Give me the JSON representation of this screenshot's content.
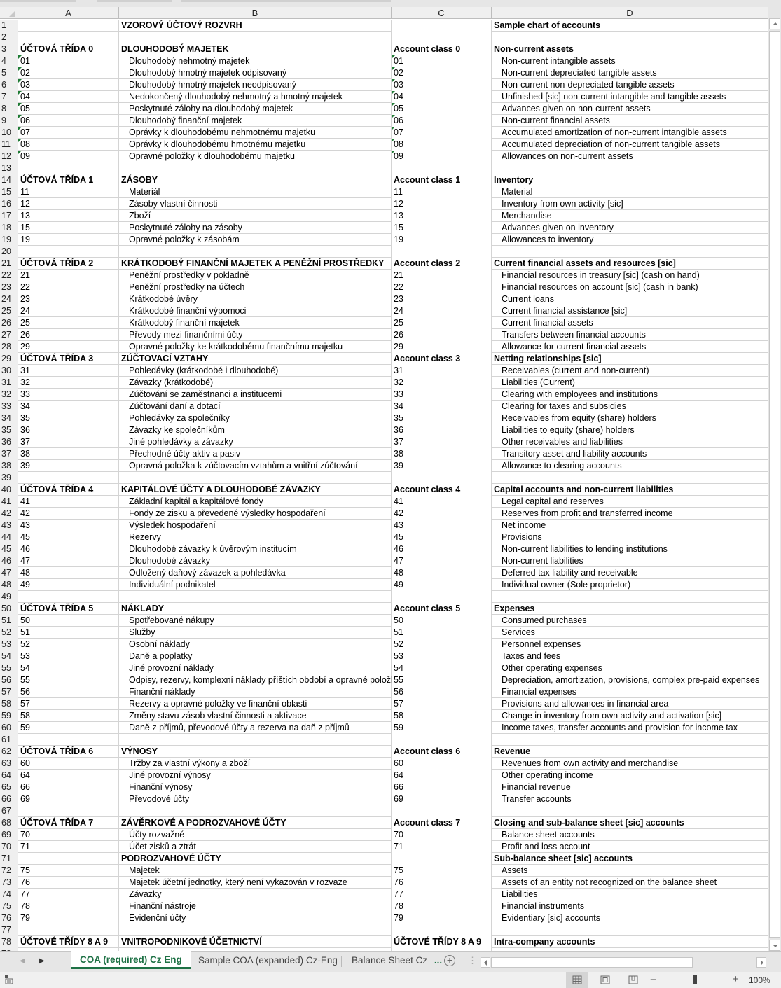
{
  "columns": [
    "A",
    "B",
    "C",
    "D"
  ],
  "rows": [
    {
      "n": "1",
      "a": "",
      "b": "VZOROVÝ ÚČTOVÝ ROZVRH",
      "c": "",
      "d": "Sample chart of accounts",
      "type": "title"
    },
    {
      "n": "2",
      "a": "",
      "b": "",
      "c": "",
      "d": "",
      "type": "blank"
    },
    {
      "n": "3",
      "a": "ÚČTOVÁ TŘÍDA 0",
      "b": "DLOUHODOBÝ MAJETEK",
      "c": "Account class 0",
      "d": "Non-current assets",
      "type": "header"
    },
    {
      "n": "4",
      "a": "01",
      "b": "Dlouhodobý nehmotný majetek",
      "c": "01",
      "d": "Non-current intangible assets",
      "type": "item",
      "tri": true
    },
    {
      "n": "5",
      "a": "02",
      "b": "Dlouhodobý hmotný majetek odpisovaný",
      "c": "02",
      "d": "Non-current depreciated tangible assets",
      "type": "item",
      "tri": true
    },
    {
      "n": "6",
      "a": "03",
      "b": "Dlouhodobý hmotný majetek neodpisovaný",
      "c": "03",
      "d": "Non-current non-depreciated tangible assets",
      "type": "item",
      "tri": true
    },
    {
      "n": "7",
      "a": "04",
      "b": "Nedokončený dlouhodobý nehmotný a hmotný majetek",
      "c": "04",
      "d": "Unfinished [sic] non-current intangible and tangible assets",
      "type": "item",
      "tri": true
    },
    {
      "n": "8",
      "a": "05",
      "b": "Poskytnuté zálohy na dlouhodobý majetek",
      "c": "05",
      "d": "Advances given on non-current assets",
      "type": "item",
      "tri": true
    },
    {
      "n": "9",
      "a": "06",
      "b": "Dlouhodobý finanční majetek",
      "c": "06",
      "d": "Non-current financial assets",
      "type": "item",
      "tri": true
    },
    {
      "n": "10",
      "a": "07",
      "b": "Oprávky k dlouhodobému nehmotnému majetku",
      "c": "07",
      "d": "Accumulated amortization of non-current intangible assets",
      "type": "item",
      "tri": true
    },
    {
      "n": "11",
      "a": "08",
      "b": "Oprávky k dlouhodobému hmotnému majetku",
      "c": "08",
      "d": "Accumulated depreciation of non-current tangible assets",
      "type": "item",
      "tri": true
    },
    {
      "n": "12",
      "a": "09",
      "b": "Opravné položky k dlouhodobému majetku",
      "c": "09",
      "d": "Allowances on non-current assets",
      "type": "item",
      "tri": true
    },
    {
      "n": "13",
      "a": "",
      "b": "",
      "c": "",
      "d": "",
      "type": "blank"
    },
    {
      "n": "14",
      "a": "ÚČTOVÁ TŘÍDA 1",
      "b": "ZÁSOBY",
      "c": "Account class 1",
      "d": "Inventory",
      "type": "header"
    },
    {
      "n": "15",
      "a": "11",
      "b": "Materiál",
      "c": "11",
      "d": "Material",
      "type": "item"
    },
    {
      "n": "16",
      "a": "12",
      "b": "Zásoby vlastní činnosti",
      "c": "12",
      "d": "Inventory from own activity [sic]",
      "type": "item"
    },
    {
      "n": "17",
      "a": "13",
      "b": "Zboží",
      "c": "13",
      "d": "Merchandise",
      "type": "item"
    },
    {
      "n": "18",
      "a": "15",
      "b": "Poskytnuté zálohy na zásoby",
      "c": "15",
      "d": "Advances given on inventory",
      "type": "item"
    },
    {
      "n": "19",
      "a": "19",
      "b": "Opravné položky k zásobám",
      "c": "19",
      "d": "Allowances to inventory",
      "type": "item"
    },
    {
      "n": "20",
      "a": "",
      "b": "",
      "c": "",
      "d": "",
      "type": "blank"
    },
    {
      "n": "21",
      "a": "ÚČTOVÁ TŘÍDA 2",
      "b": "KRÁTKODOBÝ FINANČNÍ MAJETEK A PENĚŽNÍ PROSTŘEDKY",
      "c": "Account class 2",
      "d": "Current financial assets and resources [sic]",
      "type": "header"
    },
    {
      "n": "22",
      "a": "21",
      "b": "Peněžní prostředky v pokladně",
      "c": "21",
      "d": "Financial resources in treasury [sic] (cash on hand)",
      "type": "item"
    },
    {
      "n": "23",
      "a": "22",
      "b": "Peněžní prostředky na účtech",
      "c": "22",
      "d": "Financial resources on account [sic] (cash in bank)",
      "type": "item"
    },
    {
      "n": "24",
      "a": "23",
      "b": "Krátkodobé úvěry",
      "c": "23",
      "d": "Current loans",
      "type": "item"
    },
    {
      "n": "25",
      "a": "24",
      "b": "Krátkodobé finanční výpomoci",
      "c": "24",
      "d": "Current financial assistance [sic]",
      "type": "item"
    },
    {
      "n": "26",
      "a": "25",
      "b": "Krátkodobý finanční majetek",
      "c": "25",
      "d": "Current financial assets",
      "type": "item"
    },
    {
      "n": "27",
      "a": "26",
      "b": "Převody mezi finančními účty",
      "c": "26",
      "d": "Transfers between financial accounts",
      "type": "item"
    },
    {
      "n": "28",
      "a": "29",
      "b": "Opravné položky ke krátkodobému finančnímu majetku",
      "c": "29",
      "d": "Allowance for current financial assets",
      "type": "item"
    },
    {
      "n": "29",
      "a": "ÚČTOVÁ TŘÍDA 3",
      "b": "ZÚČTOVACÍ VZTAHY",
      "c": "Account class 3",
      "d": "Netting relationships [sic]",
      "type": "header"
    },
    {
      "n": "30",
      "a": "31",
      "b": "Pohledávky (krátkodobé i dlouhodobé)",
      "c": "31",
      "d": "Receivables (current and non-current)",
      "type": "item"
    },
    {
      "n": "31",
      "a": "32",
      "b": "Závazky (krátkodobé)",
      "c": "32",
      "d": "Liabilities (Current)",
      "type": "item"
    },
    {
      "n": "32",
      "a": "33",
      "b": "Zúčtování se zaměstnanci a institucemi",
      "c": "33",
      "d": "Clearing with employees and institutions",
      "type": "item"
    },
    {
      "n": "33",
      "a": "34",
      "b": "Zúčtování daní a dotací",
      "c": "34",
      "d": "Clearing for taxes and subsidies",
      "type": "item"
    },
    {
      "n": "34",
      "a": "35",
      "b": "Pohledávky za společníky",
      "c": "35",
      "d": "Receivables from equity (share) holders",
      "type": "item"
    },
    {
      "n": "35",
      "a": "36",
      "b": "Závazky ke společníkům",
      "c": "36",
      "d": "Liabilities to equity (share) holders",
      "type": "item"
    },
    {
      "n": "36",
      "a": "37",
      "b": "Jiné pohledávky a závazky",
      "c": "37",
      "d": "Other receivables and liabilities",
      "type": "item"
    },
    {
      "n": "37",
      "a": "38",
      "b": "Přechodné účty aktiv a pasiv",
      "c": "38",
      "d": "Transitory asset and liability accounts",
      "type": "item"
    },
    {
      "n": "38",
      "a": "39",
      "b": "Opravná položka k zúčtovacím vztahům a vnitřní zúčtování",
      "c": "39",
      "d": "Allowance to clearing accounts",
      "type": "item"
    },
    {
      "n": "39",
      "a": "",
      "b": "",
      "c": "",
      "d": "",
      "type": "blank"
    },
    {
      "n": "40",
      "a": "ÚČTOVÁ TŘÍDA 4",
      "b": "KAPITÁLOVÉ ÚČTY A DLOUHODOBÉ ZÁVAZKY",
      "c": "Account class 4",
      "d": "Capital accounts and non-current liabilities",
      "type": "header"
    },
    {
      "n": "41",
      "a": "41",
      "b": "Základní kapitál a kapitálové fondy",
      "c": "41",
      "d": "Legal capital and reserves",
      "type": "item"
    },
    {
      "n": "42",
      "a": "42",
      "b": "Fondy ze zisku a převedené výsledky hospodaření",
      "c": "42",
      "d": "Reserves from profit and transferred income",
      "type": "item"
    },
    {
      "n": "43",
      "a": "43",
      "b": "Výsledek hospodaření",
      "c": "43",
      "d": "Net income",
      "type": "item"
    },
    {
      "n": "44",
      "a": "45",
      "b": "Rezervy",
      "c": "45",
      "d": "Provisions",
      "type": "item"
    },
    {
      "n": "45",
      "a": "46",
      "b": "Dlouhodobé závazky k úvěrovým institucím",
      "c": "46",
      "d": "Non-current liabilities to lending institutions",
      "type": "item"
    },
    {
      "n": "46",
      "a": "47",
      "b": "Dlouhodobé závazky",
      "c": "47",
      "d": "Non-current liabilities",
      "type": "item"
    },
    {
      "n": "47",
      "a": "48",
      "b": "Odložený daňový závazek a pohledávka",
      "c": "48",
      "d": "Deferred tax liability and receivable",
      "type": "item"
    },
    {
      "n": "48",
      "a": "49",
      "b": "Individuální podnikatel",
      "c": "49",
      "d": "Individual owner (Sole proprietor)",
      "type": "item"
    },
    {
      "n": "49",
      "a": "",
      "b": "",
      "c": "",
      "d": "",
      "type": "blank"
    },
    {
      "n": "50",
      "a": "ÚČTOVÁ TŘÍDA 5",
      "b": "NÁKLADY",
      "c": "Account class 5",
      "d": "Expenses",
      "type": "header"
    },
    {
      "n": "51",
      "a": "50",
      "b": "Spotřebované nákupy",
      "c": "50",
      "d": "Consumed purchases",
      "type": "item"
    },
    {
      "n": "52",
      "a": "51",
      "b": "Služby",
      "c": "51",
      "d": "Services",
      "type": "item"
    },
    {
      "n": "53",
      "a": "52",
      "b": "Osobní náklady",
      "c": "52",
      "d": "Personnel expenses",
      "type": "item"
    },
    {
      "n": "54",
      "a": "53",
      "b": "Daně a poplatky",
      "c": "53",
      "d": "Taxes and fees",
      "type": "item"
    },
    {
      "n": "55",
      "a": "54",
      "b": "Jiné provozní náklady",
      "c": "54",
      "d": "Other operating expenses",
      "type": "item"
    },
    {
      "n": "56",
      "a": "55",
      "b": "Odpisy, rezervy, komplexní náklady příštích období a opravné položky",
      "c": "55",
      "d": "Depreciation, amortization, provisions, complex pre-paid expenses",
      "type": "item"
    },
    {
      "n": "57",
      "a": "56",
      "b": "Finanční náklady",
      "c": "56",
      "d": "Financial expenses",
      "type": "item"
    },
    {
      "n": "58",
      "a": "57",
      "b": "Rezervy a opravné položky ve finanční oblasti",
      "c": "57",
      "d": "Provisions and allowances in financial area",
      "type": "item"
    },
    {
      "n": "59",
      "a": "58",
      "b": "Změny stavu zásob vlastní činnosti a aktivace",
      "c": "58",
      "d": "Change in inventory from own activity and activation [sic]",
      "type": "item"
    },
    {
      "n": "60",
      "a": "59",
      "b": "Daně z příjmů, převodové účty a rezerva na daň z příjmů",
      "c": "59",
      "d": "Income taxes, transfer accounts and provision for income tax",
      "type": "item"
    },
    {
      "n": "61",
      "a": "",
      "b": "",
      "c": "",
      "d": "",
      "type": "blank"
    },
    {
      "n": "62",
      "a": "ÚČTOVÁ TŘÍDA 6",
      "b": "VÝNOSY",
      "c": "Account class 6",
      "d": "Revenue",
      "type": "header"
    },
    {
      "n": "63",
      "a": "60",
      "b": "Tržby za vlastní výkony a zboží",
      "c": "60",
      "d": "Revenues from own activity and merchandise",
      "type": "item"
    },
    {
      "n": "64",
      "a": "64",
      "b": "Jiné provozní výnosy",
      "c": "64",
      "d": "Other operating income",
      "type": "item"
    },
    {
      "n": "65",
      "a": "66",
      "b": "Finanční výnosy",
      "c": "66",
      "d": "Financial revenue",
      "type": "item"
    },
    {
      "n": "66",
      "a": "69",
      "b": "Převodové účty",
      "c": "69",
      "d": "Transfer accounts",
      "type": "item"
    },
    {
      "n": "67",
      "a": "",
      "b": "",
      "c": "",
      "d": "",
      "type": "blank"
    },
    {
      "n": "68",
      "a": "ÚČTOVÁ TŘÍDA 7",
      "b": "ZÁVĚRKOVÉ A PODROZVAHOVÉ ÚČTY",
      "c": "Account class 7",
      "d": "Closing and sub-balance sheet [sic] accounts",
      "type": "header"
    },
    {
      "n": "69",
      "a": "70",
      "b": "Účty rozvažné",
      "c": "70",
      "d": "Balance sheet accounts",
      "type": "item"
    },
    {
      "n": "70",
      "a": "71",
      "b": "Účet zisků a ztrát",
      "c": "71",
      "d": "Profit and loss account",
      "type": "item"
    },
    {
      "n": "71",
      "a": "",
      "b": "PODROZVAHOVÉ ÚČTY",
      "c": "",
      "d": "Sub-balance sheet [sic] accounts",
      "type": "header"
    },
    {
      "n": "72",
      "a": "75",
      "b": "Majetek",
      "c": "75",
      "d": "Assets",
      "type": "item"
    },
    {
      "n": "73",
      "a": "76",
      "b": "Majetek účetní jednotky, který není vykazován v rozvaze",
      "c": "76",
      "d": "Assets of an entity not recognized on the balance sheet",
      "type": "item"
    },
    {
      "n": "74",
      "a": "77",
      "b": "Závazky",
      "c": "77",
      "d": "Liabilities",
      "type": "item"
    },
    {
      "n": "75",
      "a": "78",
      "b": "Finanční nástroje",
      "c": "78",
      "d": "Financial instruments",
      "type": "item"
    },
    {
      "n": "76",
      "a": "79",
      "b": "Evidenční účty",
      "c": "79",
      "d": "Evidentiary [sic] accounts",
      "type": "item"
    },
    {
      "n": "77",
      "a": "",
      "b": "",
      "c": "",
      "d": "",
      "type": "blank"
    },
    {
      "n": "78",
      "a": "ÚČTOVÉ TŘÍDY 8 A 9",
      "b": "VNITROPODNIKOVÉ ÚČETNICTVÍ",
      "c": "ÚČTOVÉ TŘÍDY 8 A 9",
      "d": "Intra-company accounts",
      "type": "header"
    },
    {
      "n": "79",
      "a": "",
      "b": "",
      "c": "",
      "d": "",
      "type": "blank"
    }
  ],
  "sheet_tabs": [
    {
      "label": "COA (required) Cz Eng",
      "active": true
    },
    {
      "label": "Sample COA (expanded) Cz-Eng",
      "active": false
    },
    {
      "label": "Balance Sheet Cz",
      "active": false
    }
  ],
  "tab_overflow": "...",
  "add_sheet_icon": "+",
  "status": {
    "zoom_minus": "−",
    "zoom_plus": "+",
    "zoom_level": "100%",
    "zoom_value_percent": 100
  },
  "accent_color": "#1e7145"
}
